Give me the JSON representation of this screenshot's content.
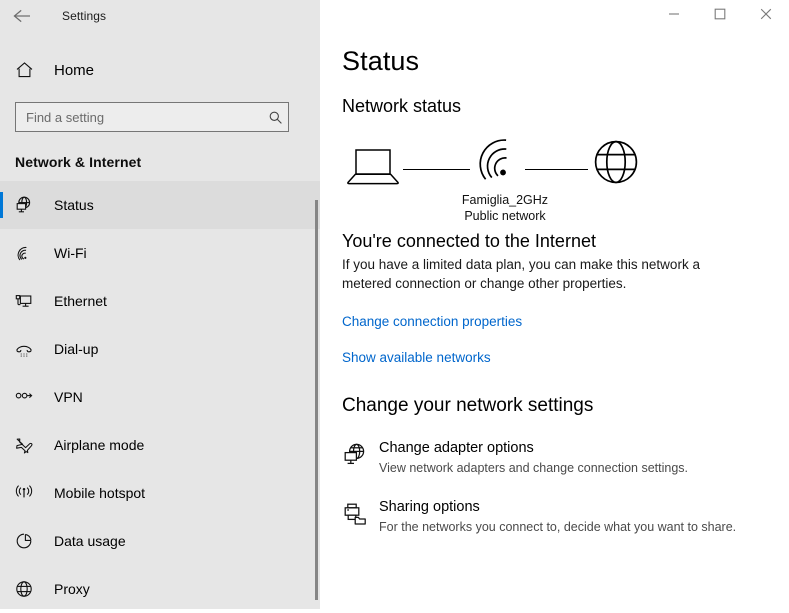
{
  "titlebar": {
    "app_title": "Settings",
    "back_icon": "back-arrow-icon",
    "minimize_label": "—",
    "maximize_label": "□",
    "close_label": "✕"
  },
  "sidebar": {
    "home_label": "Home",
    "home_icon": "home-icon",
    "search": {
      "placeholder": "Find a setting",
      "value": "",
      "icon": "search-icon"
    },
    "category": "Network & Internet",
    "items": [
      {
        "label": "Status",
        "icon": "network-status-icon",
        "selected": true
      },
      {
        "label": "Wi-Fi",
        "icon": "wifi-icon",
        "selected": false
      },
      {
        "label": "Ethernet",
        "icon": "ethernet-icon",
        "selected": false
      },
      {
        "label": "Dial-up",
        "icon": "dialup-phone-icon",
        "selected": false
      },
      {
        "label": "VPN",
        "icon": "vpn-icon",
        "selected": false
      },
      {
        "label": "Airplane mode",
        "icon": "airplane-icon",
        "selected": false
      },
      {
        "label": "Mobile hotspot",
        "icon": "hotspot-icon",
        "selected": false
      },
      {
        "label": "Data usage",
        "icon": "data-usage-pie-icon",
        "selected": false
      },
      {
        "label": "Proxy",
        "icon": "globe-icon",
        "selected": false
      }
    ]
  },
  "main": {
    "page_title": "Status",
    "network_status_heading": "Network status",
    "diagram": {
      "device_icon": "laptop-icon",
      "link_icon": "wifi-signal-icon",
      "internet_icon": "globe-icon",
      "network_name": "Famiglia_2GHz",
      "network_type": "Public network"
    },
    "connection_title": "You're connected to the Internet",
    "connection_description": "If you have a limited data plan, you can make this network a metered connection or change other properties.",
    "links": [
      {
        "label": "Change connection properties"
      },
      {
        "label": "Show available networks"
      }
    ],
    "settings_heading": "Change your network settings",
    "options": [
      {
        "title": "Change adapter options",
        "description": "View network adapters and change connection settings.",
        "icon": "adapter-globe-icon"
      },
      {
        "title": "Sharing options",
        "description": "For the networks you connect to, decide what you want to share.",
        "icon": "sharing-printer-folder-icon"
      }
    ]
  },
  "colors": {
    "accent": "#0078d7",
    "link": "#0066cc",
    "sidebar_bg": "#e6e6e6",
    "content_bg": "#ffffff"
  }
}
